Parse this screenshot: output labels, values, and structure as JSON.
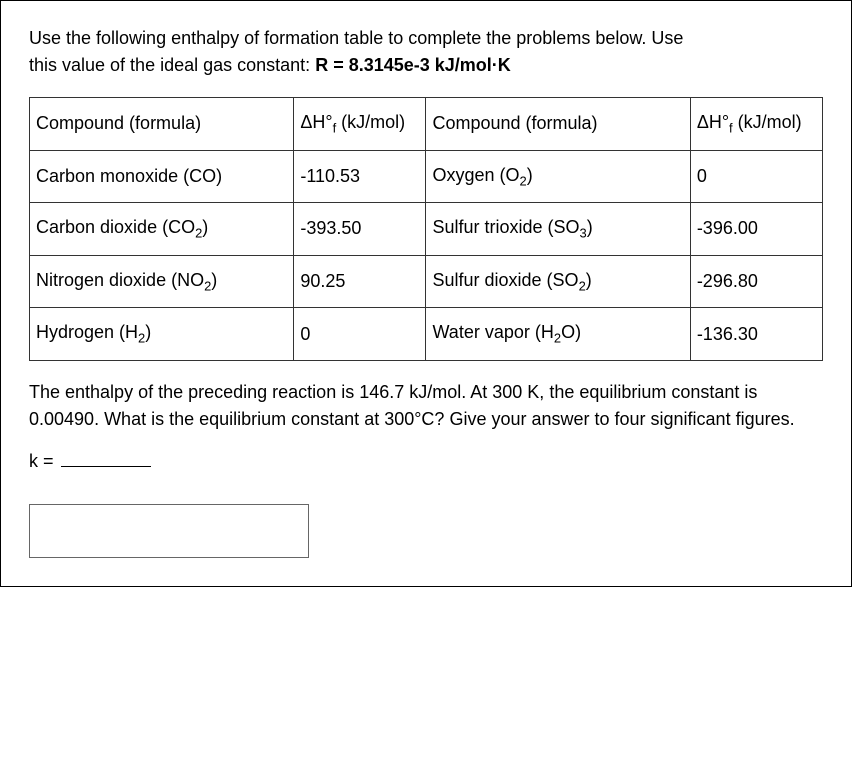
{
  "intro": {
    "line1": "Use the following enthalpy of formation table to complete the problems below. Use",
    "line2_pre": "this value of the ideal gas constant: ",
    "line2_bold": "R = 8.3145e-3 kJ/mol·K"
  },
  "table": {
    "header": {
      "compound_label": "Compound (formula)",
      "dh_label_pre": "ΔH°",
      "dh_label_sub": "f",
      "dh_label_post": " (kJ/mol)"
    },
    "rows": [
      {
        "left_name": "Carbon monoxide (CO)",
        "left_val": "-110.53",
        "right_name_pre": "Oxygen (O",
        "right_name_sub": "2",
        "right_name_post": ")",
        "right_val": "0"
      },
      {
        "left_name_pre": "Carbon dioxide (CO",
        "left_name_sub": "2",
        "left_name_post": ")",
        "left_val": "-393.50",
        "right_name_pre": "Sulfur trioxide (SO",
        "right_name_sub": "3",
        "right_name_post": ")",
        "right_val": "-396.00"
      },
      {
        "left_name_pre": "Nitrogen dioxide (NO",
        "left_name_sub": "2",
        "left_name_post": ")",
        "left_val": "90.25",
        "right_name_pre": "Sulfur dioxide (SO",
        "right_name_sub": "2",
        "right_name_post": ")",
        "right_val": "-296.80"
      },
      {
        "left_name_pre": "Hydrogen (H",
        "left_name_sub": "2",
        "left_name_post": ")",
        "left_val": "0",
        "right_name_pre": "Water vapor (H",
        "right_name_sub": "2",
        "right_name_post": "O)",
        "right_val": "-136.30"
      }
    ]
  },
  "question": {
    "text": "The enthalpy of the preceding reaction is 146.7 kJ/mol. At 300 K, the equilibrium constant is 0.00490. What is the equilibrium constant at 300°C? Give your answer to four significant figures."
  },
  "answer": {
    "k_label": "k = "
  },
  "chart_data": {
    "type": "table",
    "title": "Enthalpy of Formation",
    "columns": [
      "Compound (formula)",
      "ΔH°f (kJ/mol)"
    ],
    "rows": [
      {
        "compound": "Carbon monoxide (CO)",
        "dHf_kJ_per_mol": -110.53
      },
      {
        "compound": "Oxygen (O2)",
        "dHf_kJ_per_mol": 0
      },
      {
        "compound": "Carbon dioxide (CO2)",
        "dHf_kJ_per_mol": -393.5
      },
      {
        "compound": "Sulfur trioxide (SO3)",
        "dHf_kJ_per_mol": -396.0
      },
      {
        "compound": "Nitrogen dioxide (NO2)",
        "dHf_kJ_per_mol": 90.25
      },
      {
        "compound": "Sulfur dioxide (SO2)",
        "dHf_kJ_per_mol": -296.8
      },
      {
        "compound": "Hydrogen (H2)",
        "dHf_kJ_per_mol": 0
      },
      {
        "compound": "Water vapor (H2O)",
        "dHf_kJ_per_mol": -136.3
      }
    ],
    "constants": {
      "R_kJ_per_mol_K": 0.0083145
    },
    "question": {
      "enthalpy_kJ_per_mol": 146.7,
      "T1_K": 300,
      "K1": 0.0049,
      "T2_label": "300°C",
      "sig_figs": 4
    }
  }
}
